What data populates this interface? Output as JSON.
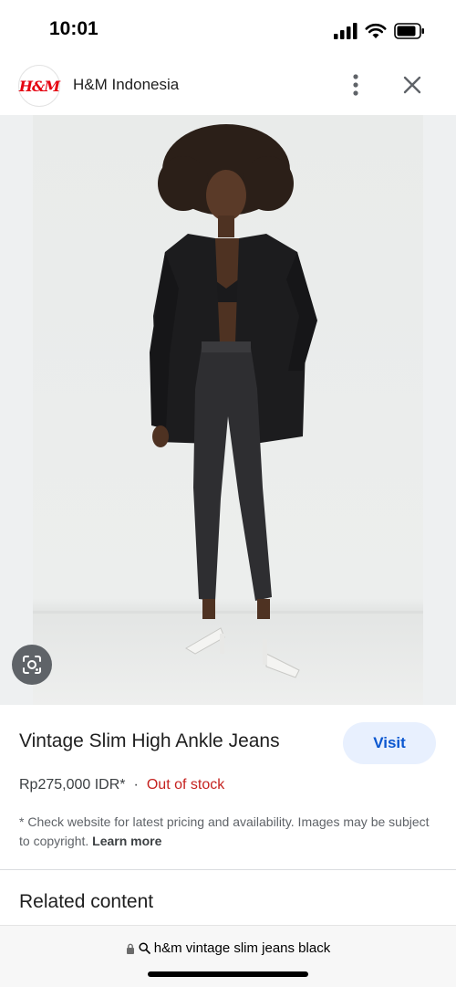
{
  "status_bar": {
    "time": "10:01",
    "icons": [
      "signal-icon",
      "wifi-icon",
      "battery-icon"
    ]
  },
  "header": {
    "logo_text": "H&M",
    "site_name": "H&M Indonesia",
    "icons": [
      "more-vert-icon",
      "close-icon"
    ]
  },
  "product": {
    "title": "Vintage Slim High Ankle Jeans",
    "visit_label": "Visit",
    "price": "Rp275,000 IDR*",
    "separator": "·",
    "stock_status": "Out of stock",
    "disclaimer": "* Check website for latest pricing and availability. Images may be subject to copyright.",
    "learn_more": "Learn more"
  },
  "related": {
    "heading": "Related content"
  },
  "url_bar": {
    "query": "h&m vintage slim jeans black"
  },
  "colors": {
    "accent_blue": "#0b57d0",
    "visit_bg": "#e8f0fe",
    "out_of_stock_red": "#c5221f",
    "brand_red": "#e50010"
  }
}
